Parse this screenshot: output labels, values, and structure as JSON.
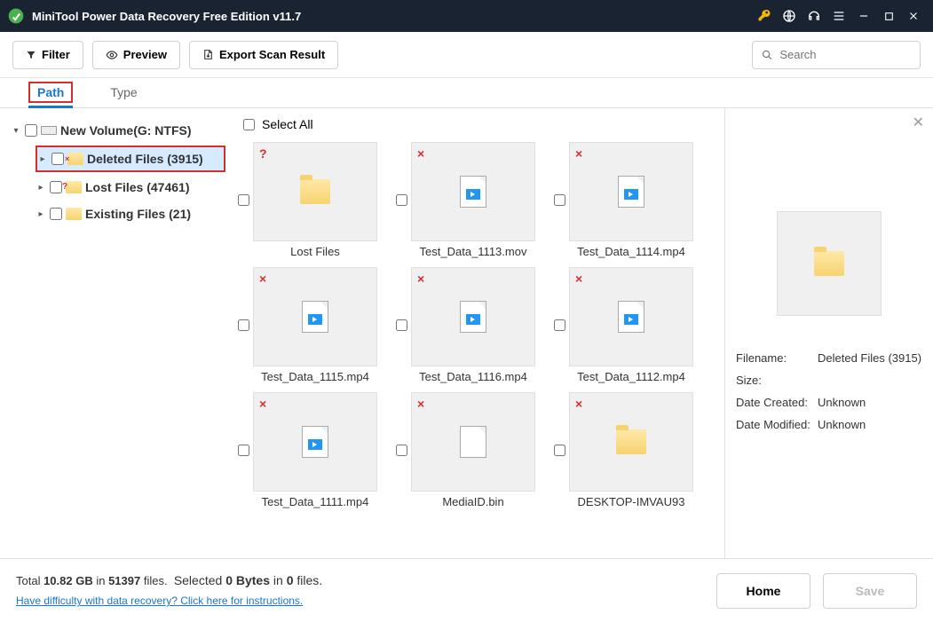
{
  "title": "MiniTool Power Data Recovery Free Edition v11.7",
  "toolbar": {
    "filter": "Filter",
    "preview": "Preview",
    "export": "Export Scan Result",
    "search_placeholder": "Search"
  },
  "tabs": {
    "path": "Path",
    "type": "Type"
  },
  "tree": {
    "root": "New Volume(G: NTFS)",
    "items": [
      {
        "label": "Deleted Files (3915)"
      },
      {
        "label": "Lost Files (47461)"
      },
      {
        "label": "Existing Files (21)"
      }
    ]
  },
  "select_all": "Select All",
  "files": [
    {
      "name": "Lost Files",
      "badge": "?",
      "type": "folder"
    },
    {
      "name": "Test_Data_1113.mov",
      "badge": "×",
      "type": "video"
    },
    {
      "name": "Test_Data_1114.mp4",
      "badge": "×",
      "type": "video"
    },
    {
      "name": "Test_Data_1115.mp4",
      "badge": "×",
      "type": "video"
    },
    {
      "name": "Test_Data_1116.mp4",
      "badge": "×",
      "type": "video"
    },
    {
      "name": "Test_Data_1112.mp4",
      "badge": "×",
      "type": "video"
    },
    {
      "name": "Test_Data_1111.mp4",
      "badge": "×",
      "type": "video"
    },
    {
      "name": "MediaID.bin",
      "badge": "×",
      "type": "file"
    },
    {
      "name": "DESKTOP-IMVAU93",
      "badge": "×",
      "type": "folder"
    }
  ],
  "details": {
    "filename_label": "Filename:",
    "filename": "Deleted Files (3915)",
    "size_label": "Size:",
    "size": "",
    "created_label": "Date Created:",
    "created": "Unknown",
    "modified_label": "Date Modified:",
    "modified": "Unknown"
  },
  "footer": {
    "total_prefix": "Total ",
    "total_size": "10.82 GB",
    "total_mid": " in ",
    "total_files": "51397",
    "total_suffix": " files.",
    "sel_prefix": "Selected ",
    "sel_bytes": "0 Bytes",
    "sel_mid": " in ",
    "sel_files": "0",
    "sel_suffix": " files.",
    "help": "Have difficulty with data recovery? Click here for instructions.",
    "home": "Home",
    "save": "Save"
  }
}
